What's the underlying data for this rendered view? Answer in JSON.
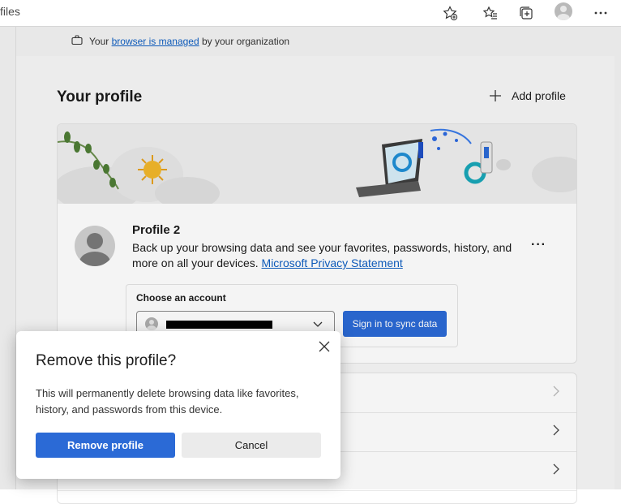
{
  "toolbar": {
    "address_text": "files",
    "icons": [
      "favorite-add-icon",
      "favorites-icon",
      "collections-icon",
      "profile-avatar-icon",
      "more-icon"
    ]
  },
  "managed_notice": {
    "prefix": "Your ",
    "link": "browser is managed",
    "suffix": " by your organization"
  },
  "profile_section": {
    "title": "Your profile",
    "add_profile_label": "Add profile"
  },
  "profile_card": {
    "name": "Profile 2",
    "description": "Back up your browsing data and see your favorites, passwords, history, and more on all your devices. ",
    "privacy_link": "Microsoft Privacy Statement",
    "more_label": "···",
    "choose_account_label": "Choose an account",
    "sync_button_label": "Sign in to sync data"
  },
  "dialog": {
    "title": "Remove this profile?",
    "body": "This will permanently delete browsing data like favorites, history, and passwords from this device.",
    "remove_label": "Remove profile",
    "cancel_label": "Cancel"
  },
  "colors": {
    "accent": "#2b6ad6",
    "link": "#0f5fc2",
    "page_bg": "#f3f3f3"
  }
}
